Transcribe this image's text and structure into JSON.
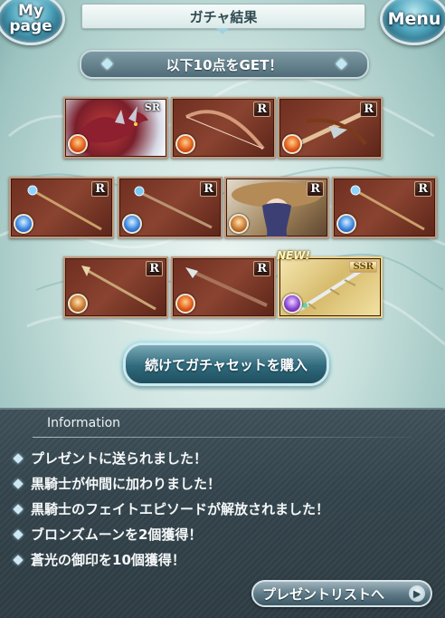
{
  "header": {
    "title": "ガチャ結果",
    "mypage_label": "My page",
    "menu_label": "Menu"
  },
  "banner": {
    "text": "以下10点をGET！"
  },
  "items": [
    {
      "rarity": "SR",
      "element": "fire",
      "art": "dragon-icon"
    },
    {
      "rarity": "R",
      "element": "fire",
      "art": "bow-icon"
    },
    {
      "rarity": "R",
      "element": "fire",
      "art": "crossbow-icon"
    },
    {
      "rarity": "R",
      "element": "water",
      "art": "staff-icon"
    },
    {
      "rarity": "R",
      "element": "water",
      "art": "staff-icon"
    },
    {
      "rarity": "R",
      "element": "earth",
      "art": "character-icon"
    },
    {
      "rarity": "R",
      "element": "water",
      "art": "staff-icon"
    },
    {
      "rarity": "R",
      "element": "earth",
      "art": "staff-icon"
    },
    {
      "rarity": "R",
      "element": "fire",
      "art": "spear-icon"
    },
    {
      "rarity": "SSR",
      "element": "dark",
      "art": "sword-icon",
      "new_label": "NEW!"
    }
  ],
  "cta": {
    "label": "続けてガチャセットを購入"
  },
  "information": {
    "title": "Information",
    "messages": [
      "プレゼントに送られました！",
      "黒騎士が仲間に加わりました！",
      "黒騎士のフェイトエピソードが解放されました！",
      "ブロンズムーンを2個獲得！",
      "蒼光の御印を10個獲得！"
    ],
    "present_list_label": "プレゼントリストへ"
  },
  "colors": {
    "panel": "#33434b",
    "accent": "#7fe4f5",
    "item_frame": "#c09a7d"
  }
}
